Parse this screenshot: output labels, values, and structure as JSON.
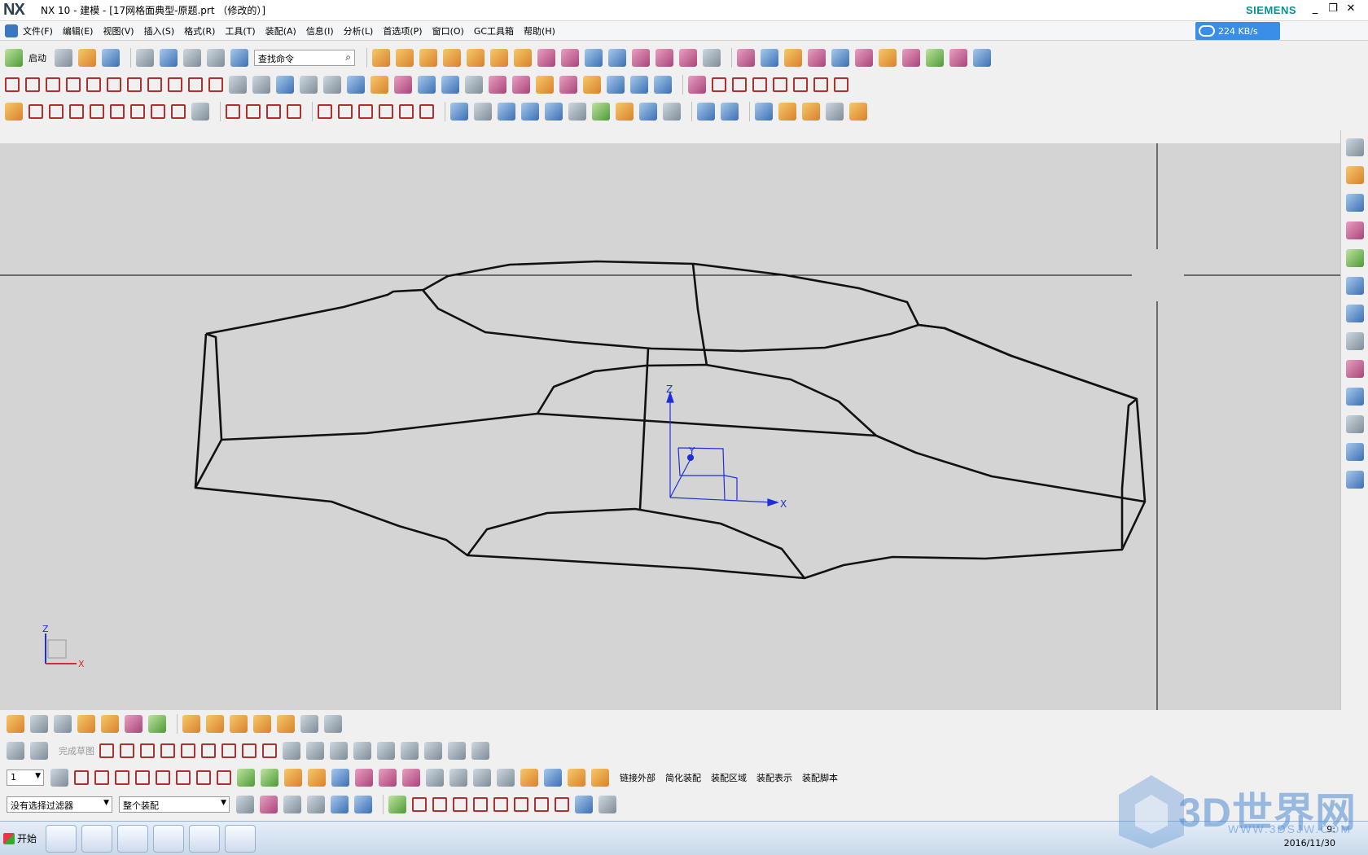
{
  "app": {
    "logo": "NX",
    "title": "NX 10 - 建模 - [17网格面典型-原题.prt （修改的）]",
    "brand": "SIEMENS",
    "download_speed": "224 KB/s",
    "window_controls": [
      "_",
      "❐",
      "✕"
    ]
  },
  "menu": {
    "items": [
      "文件(F)",
      "编辑(E)",
      "视图(V)",
      "插入(S)",
      "格式(R)",
      "工具(T)",
      "装配(A)",
      "信息(I)",
      "分析(L)",
      "首选项(P)",
      "窗口(O)",
      "GC工具箱",
      "帮助(H)"
    ]
  },
  "toolbar1": {
    "start_label": "启动",
    "search_placeholder": "查找命令"
  },
  "bottom_toolbar": {
    "finish_sketch": "完成草图",
    "assembly_buttons": [
      "链接外部",
      "简化装配",
      "装配区域",
      "装配表示",
      "装配脚本"
    ],
    "layer_value": "1"
  },
  "selection_bar": {
    "filter_value": "没有选择过滤器",
    "scope_value": "整个装配"
  },
  "viewport": {
    "triad_labels": {
      "x": "X",
      "y": "Y",
      "z": "Z"
    },
    "corner_triad_labels": {
      "x": "X",
      "z": "Z"
    }
  },
  "taskbar": {
    "start_label": "开始",
    "date": "2016/11/30",
    "time": "9:"
  },
  "watermark": {
    "text": "3D世界网",
    "url": "WWW.3DSJW.COM"
  },
  "colors": {
    "viewport_bg": "#d4d4d4",
    "wire": "#111111",
    "triad": "#1f2fd6",
    "brand": "#0a8f8f",
    "speed_bg": "#3a8ee6"
  }
}
